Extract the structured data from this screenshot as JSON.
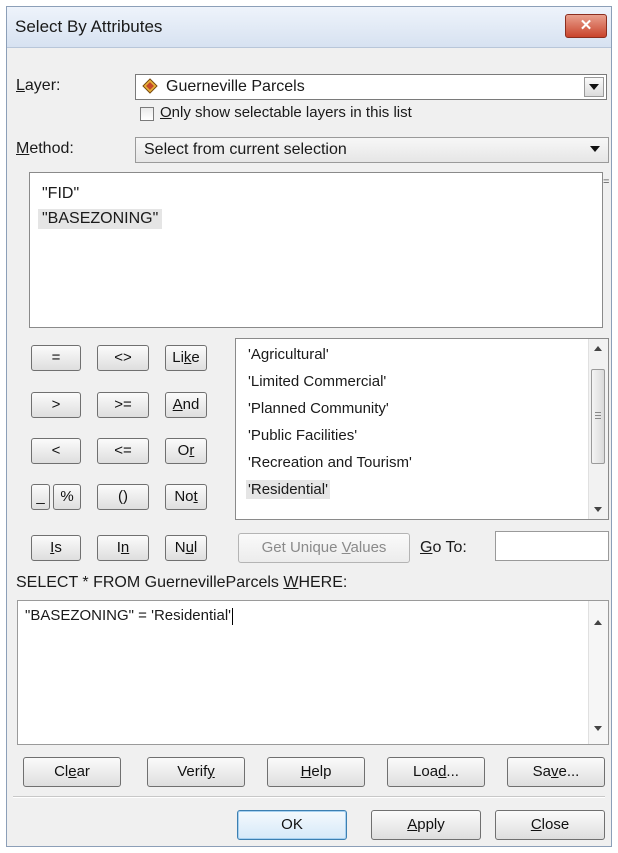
{
  "window": {
    "title": "Select By Attributes",
    "close_symbol": "✕"
  },
  "layer": {
    "label_u": "L",
    "label_rest": "ayer:",
    "value": "Guerneville Parcels",
    "only_selectable_u": "O",
    "only_selectable_rest": "nly show selectable layers in this list"
  },
  "method": {
    "label_u": "M",
    "label_rest": "ethod:",
    "value": "Select from current selection"
  },
  "fields": [
    "\"FID\"",
    "\"BASEZONING\""
  ],
  "operators": {
    "eq": "=",
    "neq": "<>",
    "like_a": "Li",
    "like_u": "k",
    "like_b": "e",
    "gt": ">",
    "gte": ">=",
    "and_u": "A",
    "and_rest": "nd",
    "lt": "<",
    "lte": "<=",
    "or_a": "O",
    "or_u": "r",
    "underscore": "_",
    "percent": "%",
    "parens": "()",
    "not_a": "No",
    "not_u": "t",
    "is_u": "I",
    "is_rest": "s",
    "in_a": "I",
    "in_u": "n",
    "null_a": "N",
    "null_u": "u",
    "null_b": "l"
  },
  "values": [
    "'Agricultural'",
    "'Limited Commercial'",
    "'Planned Community'",
    "'Public Facilities'",
    "'Recreation and Tourism'",
    "'Residential'"
  ],
  "get_unique": {
    "a": "Get Unique ",
    "u": "V",
    "b": "alues"
  },
  "goto": {
    "u": "G",
    "rest": "o To:",
    "value": ""
  },
  "sql": {
    "prefix": "SELECT * FROM GuernevilleParcels ",
    "u": "W",
    "rest": "HERE:",
    "expression": "\"BASEZONING\" = 'Residential'"
  },
  "actions": {
    "clear_a": "Cl",
    "clear_u": "e",
    "clear_b": "ar",
    "verify_a": "Verif",
    "verify_u": "y",
    "help_u": "H",
    "help_rest": "elp",
    "load_a": "Loa",
    "load_u": "d",
    "load_b": "...",
    "save_a": "Sa",
    "save_u": "v",
    "save_b": "e..."
  },
  "footer": {
    "ok": "OK",
    "apply_u": "A",
    "apply_rest": "pply",
    "close_u": "C",
    "close_rest": "lose"
  }
}
